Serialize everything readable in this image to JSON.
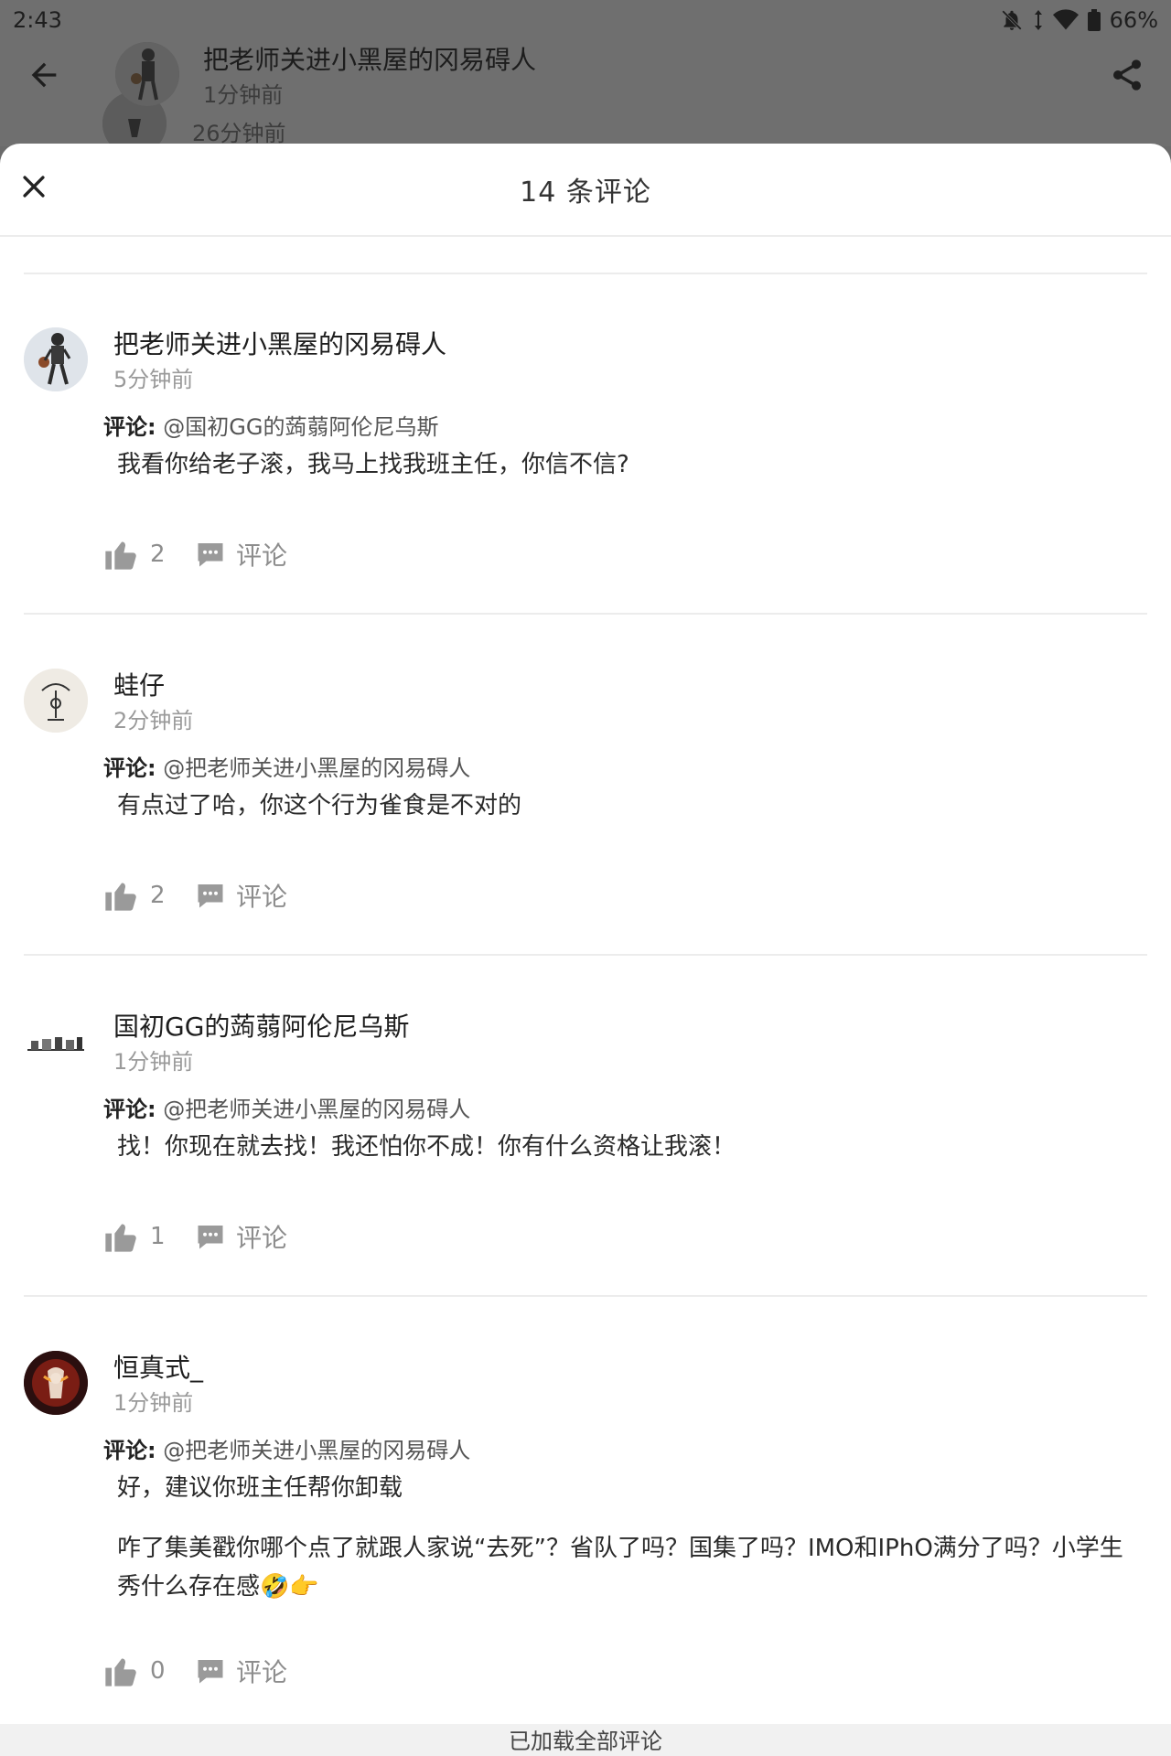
{
  "status_bar": {
    "time": "2:43",
    "battery": "66%"
  },
  "background_header": {
    "title": "把老师关进小黑屋的冈易碍人",
    "time": "1分钟前",
    "time_behind": "26分钟前"
  },
  "sheet": {
    "title": "14 条评论",
    "footer": "已加载全部评论"
  },
  "reply_label": "评论:",
  "comments": [
    {
      "name": "把老师关进小黑屋的冈易碍人",
      "time": "5分钟前",
      "reply_to": "@国初GG的蒟蒻阿伦尼乌斯",
      "text": "我看你给老子滚，我马上找我班主任，你信不信?",
      "likes": "2",
      "comment_label": "评论"
    },
    {
      "name": "蛙仔",
      "time": "2分钟前",
      "reply_to": "@把老师关进小黑屋的冈易碍人",
      "text": "有点过了哈，你这个行为雀食是不对的",
      "likes": "2",
      "comment_label": "评论"
    },
    {
      "name": "国初GG的蒟蒻阿伦尼乌斯",
      "time": "1分钟前",
      "reply_to": "@把老师关进小黑屋的冈易碍人",
      "text": "找！你现在就去找！我还怕你不成！你有什么资格让我滚！",
      "likes": "1",
      "comment_label": "评论"
    },
    {
      "name": "恒真式_",
      "time": "1分钟前",
      "reply_to": "@把老师关进小黑屋的冈易碍人",
      "text": "好，建议你班主任帮你卸载",
      "text2": "咋了集美戳你哪个点了就跟人家说“去死”？省队了吗？国集了吗？IMO和IPhO满分了吗？小学生秀什么存在感🤣👉",
      "likes": "0",
      "comment_label": "评论"
    }
  ]
}
